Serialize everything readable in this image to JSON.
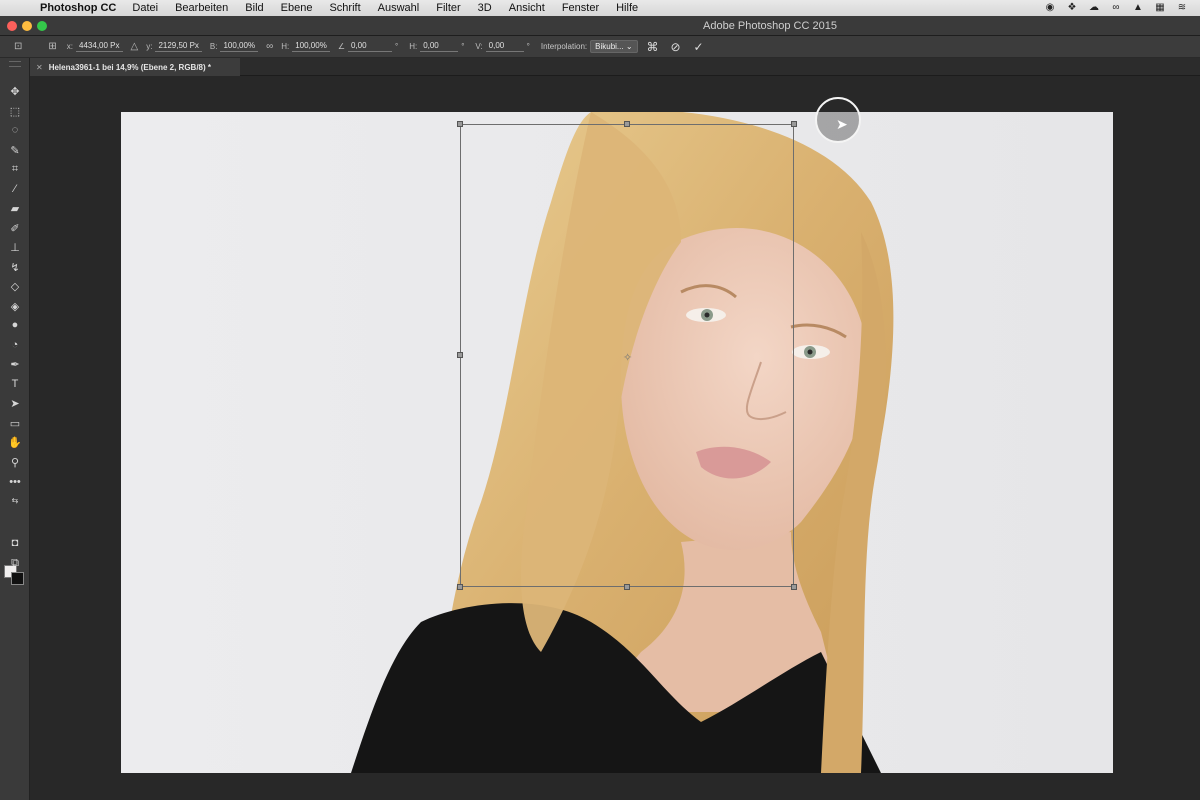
{
  "menubar": {
    "apple": "",
    "app_name": "Photoshop CC",
    "items": [
      "Datei",
      "Bearbeiten",
      "Bild",
      "Ebene",
      "Schrift",
      "Auswahl",
      "Filter",
      "3D",
      "Ansicht",
      "Fenster",
      "Hilfe"
    ]
  },
  "window": {
    "title": "Adobe Photoshop CC 2015",
    "traffic_colors": [
      "#fc605b",
      "#fdbc40",
      "#34c84a"
    ]
  },
  "options": {
    "x_label": "x:",
    "x_value": "4434,00 Px",
    "y_label": "y:",
    "y_value": "2129,50 Px",
    "w_label": "B:",
    "w_value": "100,00%",
    "h_label": "H:",
    "h_value": "100,00%",
    "angle_value": "0,00",
    "angle_unit": "°",
    "hskew_label": "H:",
    "hskew_value": "0,00",
    "hskew_unit": "°",
    "vskew_label": "V:",
    "vskew_value": "0,00",
    "vskew_unit": "°",
    "interp_label": "Interpolation:",
    "interp_value": "Bikubi..."
  },
  "document": {
    "tab_title": "Helena3961-1 bei 14,9% (Ebene 2, RGB/8) *"
  },
  "colors": {
    "foreground": "#f1efef",
    "background": "#111111"
  }
}
